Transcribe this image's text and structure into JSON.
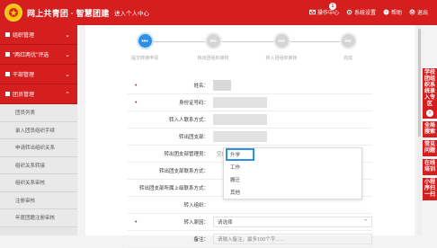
{
  "header": {
    "brand": "网上共青团 · 智慧团建",
    "center_link": "进入个人中心",
    "actions": [
      {
        "label": "操作中心",
        "icon": "mail-icon",
        "badge": "1"
      },
      {
        "label": "系统设置",
        "icon": "gear-icon"
      },
      {
        "label": "帮助",
        "icon": "help-icon"
      },
      {
        "label": "退出",
        "icon": "power-icon"
      }
    ]
  },
  "sidebar": {
    "groups": [
      {
        "label": "组织管理",
        "expanded": false
      },
      {
        "label": "\"两红两优\"评选",
        "expanded": false
      },
      {
        "label": "干部管理",
        "expanded": false
      },
      {
        "label": "团员管理",
        "expanded": true
      }
    ],
    "items": [
      "团员列表",
      "录入团员组织手续",
      "申请转出组织关系",
      "组织关系转接",
      "组织关系审核",
      "注册审核",
      "年度团籍注册审核"
    ]
  },
  "steps": {
    "items": [
      {
        "icon_text": "•••",
        "label": "提交转接申请",
        "active": true
      },
      {
        "icon_text": "•••",
        "label": "转出团组织审核",
        "active": false
      },
      {
        "icon_text": "•••",
        "label": "转入团组织审核",
        "active": false
      },
      {
        "icon_text": "•••",
        "label": "完成",
        "active": false
      }
    ]
  },
  "form": {
    "rows": [
      {
        "label": "姓名：",
        "required": true,
        "value": ""
      },
      {
        "label": "身份证号码：",
        "required": true,
        "value": ""
      },
      {
        "label": "转入人联系方式：",
        "required": false,
        "value": ""
      },
      {
        "label": "转出团支部：",
        "required": false,
        "value": ""
      },
      {
        "label": "转出团支部管理员：",
        "required": false,
        "value": "空白"
      },
      {
        "label": "转出团支部联系方式：",
        "required": false,
        "value": ""
      },
      {
        "label": "转出团支部所属上级联系方式：",
        "required": false,
        "value": ""
      },
      {
        "label": "转入组织：",
        "required": false,
        "value": ""
      },
      {
        "label": "转入原因：",
        "required": true,
        "value": "请选择"
      },
      {
        "label": "备注：",
        "required": false,
        "value": "",
        "placeholder": "请输入备注，最多100个字……"
      }
    ]
  },
  "dropdown": {
    "options": [
      "升学",
      "工作",
      "搬迁",
      "其他"
    ],
    "highlighted": "升学"
  },
  "right_float": {
    "buttons": [
      "学校团组织系统录入专区",
      "全局搜索",
      "常见问题",
      "在线培训",
      "小程序扫一扫"
    ]
  },
  "colors": {
    "brand_red": "#d51e1e",
    "accent_blue": "#2e8fe5"
  }
}
